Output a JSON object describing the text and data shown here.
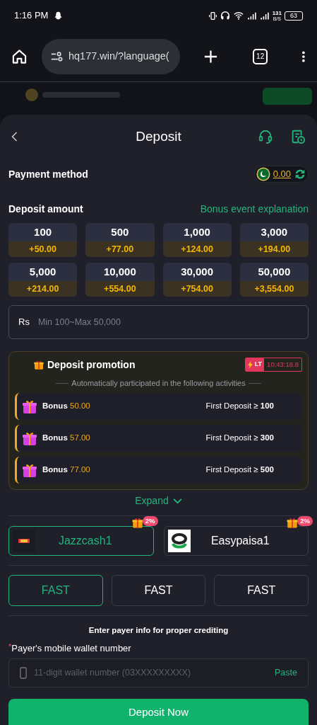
{
  "status_bar": {
    "time": "1:16 PM",
    "speed": "131",
    "speed_unit": "B/S",
    "battery": "63"
  },
  "browser": {
    "url": "hq177.win/?language(",
    "tab_count": "12"
  },
  "header": {
    "title": "Deposit"
  },
  "payment_method": {
    "label": "Payment method",
    "balance": "0.00"
  },
  "deposit_amount": {
    "label": "Deposit amount",
    "link": "Bonus event explanation"
  },
  "amounts": [
    {
      "amount": "100",
      "bonus": "+50.00",
      "selected": false
    },
    {
      "amount": "500",
      "bonus": "+77.00",
      "selected": false
    },
    {
      "amount": "1,000",
      "bonus": "+124.00",
      "selected": false
    },
    {
      "amount": "3,000",
      "bonus": "+194.00",
      "selected": false
    },
    {
      "amount": "5,000",
      "bonus": "+214.00",
      "selected": false
    },
    {
      "amount": "10,000",
      "bonus": "+554.00",
      "selected": false
    },
    {
      "amount": "30,000",
      "bonus": "+754.00",
      "selected": false
    },
    {
      "amount": "50,000",
      "bonus": "+3,554.00",
      "selected": false
    }
  ],
  "amount_field": {
    "prefix": "Rs",
    "placeholder": "Min 100~Max 50,000"
  },
  "promotion": {
    "title": "Deposit promotion",
    "badge": "LT",
    "timer": "10:43:18.8",
    "subtitle": "Automatically participated in the following activities",
    "items": [
      {
        "label": "Bonus",
        "amount": "50.00",
        "condition": "First Deposit ≥",
        "threshold": "100"
      },
      {
        "label": "Bonus",
        "amount": "57.00",
        "condition": "First Deposit ≥",
        "threshold": "300"
      },
      {
        "label": "Bonus",
        "amount": "77.00",
        "condition": "First Deposit ≥",
        "threshold": "500"
      }
    ],
    "expand": "Expand"
  },
  "channels": [
    {
      "name": "Jazzcash1",
      "badge": "2%",
      "selected": true,
      "kind": "jazzcash"
    },
    {
      "name": "Easypaisa1",
      "badge": "2%",
      "selected": false,
      "kind": "easypaisa"
    }
  ],
  "speeds": [
    {
      "label": "FAST",
      "selected": true
    },
    {
      "label": "FAST",
      "selected": false
    },
    {
      "label": "FAST",
      "selected": false
    }
  ],
  "payer_info": {
    "title": "Enter payer info for proper crediting",
    "label": "Payer's mobile wallet number",
    "required_mark": "*",
    "placeholder": "11-digit wallet number (03XXXXXXXXX)",
    "action": "Paste"
  },
  "submit": "Deposit Now"
}
